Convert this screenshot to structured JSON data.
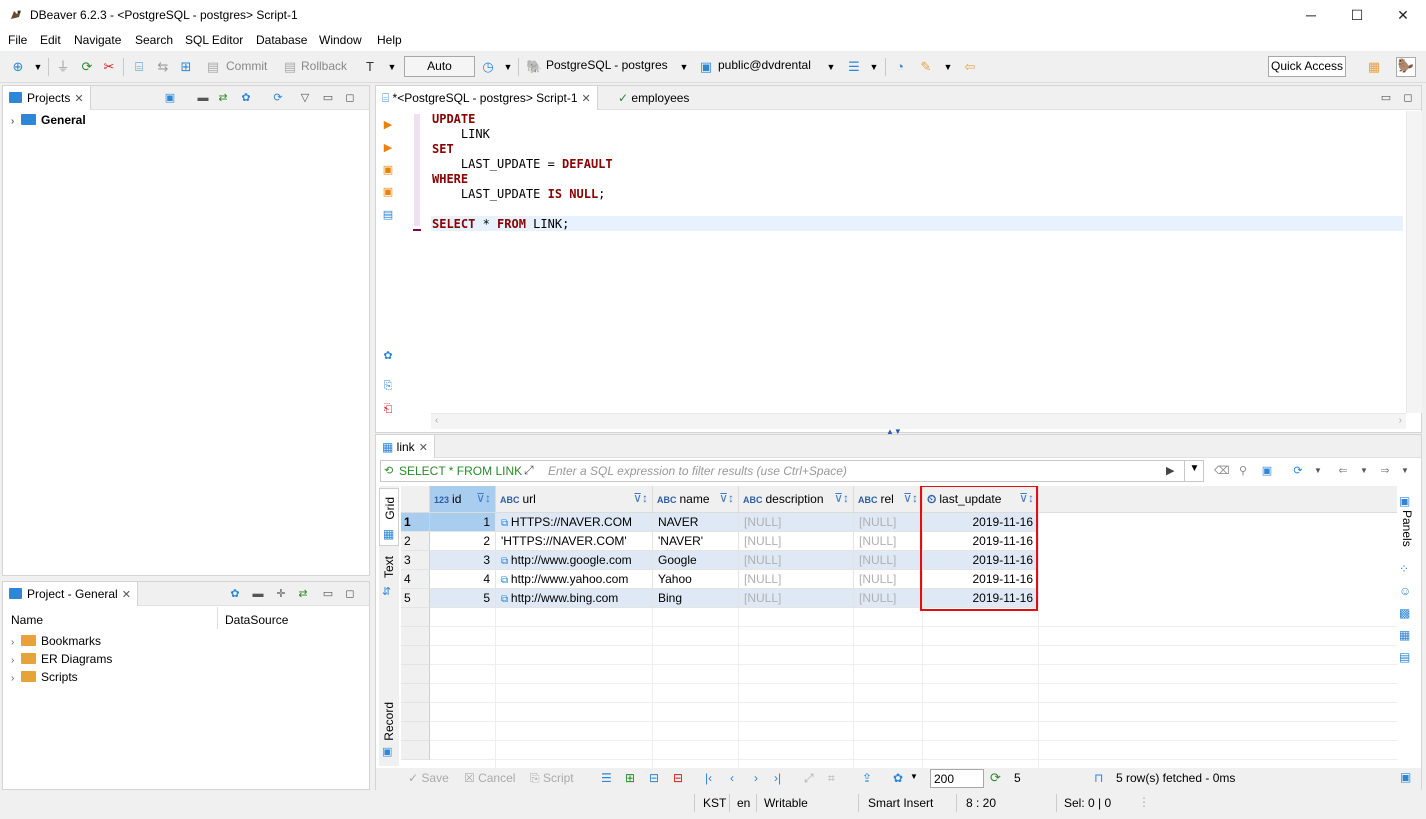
{
  "window": {
    "title": "DBeaver 6.2.3 - <PostgreSQL - postgres> Script-1",
    "controls": [
      "─",
      "☐",
      "✕"
    ]
  },
  "menu": [
    "File",
    "Edit",
    "Navigate",
    "Search",
    "SQL Editor",
    "Database",
    "Window",
    "Help"
  ],
  "toolbar": {
    "commit": "Commit",
    "rollback": "Rollback",
    "mode": "Auto",
    "connection": "PostgreSQL - postgres",
    "schema": "public@dvdrental",
    "quick_access": "Quick Access"
  },
  "projects_panel": {
    "tab": "Projects",
    "items": [
      {
        "label": "General"
      }
    ]
  },
  "project_general_panel": {
    "tab": "Project - General",
    "columns": [
      "Name",
      "DataSource"
    ],
    "items": [
      {
        "label": "Bookmarks",
        "color": "#e8a23a"
      },
      {
        "label": "ER Diagrams",
        "color": "#e8a23a"
      },
      {
        "label": "Scripts",
        "color": "#e8a23a"
      }
    ]
  },
  "editor": {
    "tabs": [
      {
        "label": "*<PostgreSQL - postgres> Script-1",
        "active": true
      },
      {
        "label": "employees",
        "active": false
      }
    ],
    "lines": [
      [
        {
          "t": "UPDATE",
          "k": true
        }
      ],
      [
        {
          "t": "    LINK",
          "k": false
        }
      ],
      [
        {
          "t": "SET",
          "k": true
        }
      ],
      [
        {
          "t": "    LAST_UPDATE = ",
          "k": false
        },
        {
          "t": "DEFAULT",
          "k": true
        }
      ],
      [
        {
          "t": "WHERE",
          "k": true
        }
      ],
      [
        {
          "t": "    LAST_UPDATE ",
          "k": false
        },
        {
          "t": "IS NULL",
          "k": true
        },
        {
          "t": ";",
          "k": false
        }
      ],
      [
        {
          "t": "",
          "k": false
        }
      ],
      [
        {
          "t": "SELECT",
          "k": true
        },
        {
          "t": " * ",
          "k": false
        },
        {
          "t": "FROM",
          "k": true
        },
        {
          "t": " LINK;",
          "k": false
        }
      ]
    ]
  },
  "results": {
    "tab": "link",
    "query": "SELECT * FROM LINK",
    "filter_placeholder": "Enter a SQL expression to filter results (use Ctrl+Space)",
    "side_tabs": [
      "Grid",
      "Text",
      "Record"
    ],
    "panels_label": "Panels",
    "columns": [
      {
        "name": "id",
        "badge": "123"
      },
      {
        "name": "url",
        "badge": "ABC"
      },
      {
        "name": "name",
        "badge": "ABC"
      },
      {
        "name": "description",
        "badge": "ABC"
      },
      {
        "name": "rel",
        "badge": "ABC"
      },
      {
        "name": "last_update",
        "badge": "⏲"
      }
    ],
    "rows": [
      {
        "num": "1",
        "id": "1",
        "url": "HTTPS://NAVER.COM",
        "url_link": true,
        "name": "NAVER",
        "description": "[NULL]",
        "rel": "[NULL]",
        "last_update": "2019-11-16"
      },
      {
        "num": "2",
        "id": "2",
        "url": "'HTTPS://NAVER.COM'",
        "url_link": false,
        "name": "'NAVER'",
        "description": "[NULL]",
        "rel": "[NULL]",
        "last_update": "2019-11-16"
      },
      {
        "num": "3",
        "id": "3",
        "url": "http://www.google.com",
        "url_link": true,
        "name": "Google",
        "description": "[NULL]",
        "rel": "[NULL]",
        "last_update": "2019-11-16"
      },
      {
        "num": "4",
        "id": "4",
        "url": "http://www.yahoo.com",
        "url_link": true,
        "name": "Yahoo",
        "description": "[NULL]",
        "rel": "[NULL]",
        "last_update": "2019-11-16"
      },
      {
        "num": "5",
        "id": "5",
        "url": "http://www.bing.com",
        "url_link": true,
        "name": "Bing",
        "description": "[NULL]",
        "rel": "[NULL]",
        "last_update": "2019-11-16"
      }
    ],
    "highlight_color": "#e01010",
    "bottom": {
      "save": "Save",
      "cancel": "Cancel",
      "script": "Script",
      "fetch_size": "200",
      "row_count": "5",
      "status": "5 row(s) fetched - 0ms"
    }
  },
  "statusbar": [
    "KST",
    "en",
    "Writable",
    "Smart Insert",
    "8 : 20",
    "Sel: 0 | 0"
  ]
}
